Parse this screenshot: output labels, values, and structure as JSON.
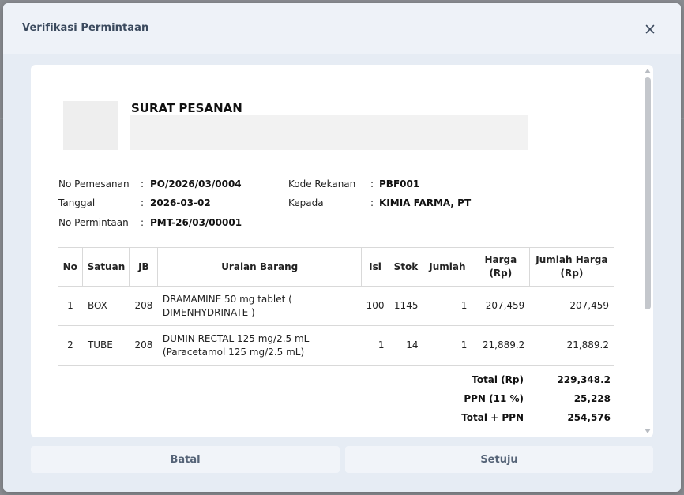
{
  "modal": {
    "title": "Verifikasi Permintaan"
  },
  "document": {
    "title": "SURAT PESANAN",
    "meta": {
      "no_pemesanan_label": "No Pemesanan",
      "no_pemesanan": "PO/2026/03/0004",
      "tanggal_label": "Tanggal",
      "tanggal": "2026-03-02",
      "no_permintaan_label": "No Permintaan",
      "no_permintaan": "PMT-26/03/00001",
      "kode_rekanan_label": "Kode Rekanan",
      "kode_rekanan": "PBF001",
      "kepada_label": "Kepada",
      "kepada": "KIMIA FARMA, PT",
      "colon": ":"
    },
    "table": {
      "headers": {
        "no": "No",
        "satuan": "Satuan",
        "jb": "JB",
        "uraian": "Uraian Barang",
        "isi": "Isi",
        "stok": "Stok",
        "jumlah": "Jumlah",
        "harga_1": "Harga",
        "harga_2": "(Rp)",
        "jumlah_harga_1": "Jumlah Harga",
        "jumlah_harga_2": "(Rp)"
      },
      "rows": [
        {
          "no": "1",
          "satuan": "BOX",
          "jb": "208",
          "uraian_1": "DRAMAMINE 50 mg tablet (",
          "uraian_2": "DIMENHYDRINATE )",
          "isi": "100",
          "stok": "1145",
          "jumlah": "1",
          "harga": "207,459",
          "jumlah_harga": "207,459"
        },
        {
          "no": "2",
          "satuan": "TUBE",
          "jb": "208",
          "uraian_1": "DUMIN RECTAL 125 mg/2.5 mL",
          "uraian_2": "(Paracetamol 125 mg/2.5 mL)",
          "isi": "1",
          "stok": "14",
          "jumlah": "1",
          "harga": "21,889.2",
          "jumlah_harga": "21,889.2"
        }
      ]
    },
    "totals": {
      "total_label": "Total (Rp)",
      "total": "229,348.2",
      "ppn_label": "PPN (11 %)",
      "ppn": "25,228",
      "grand_label": "Total + PPN",
      "grand": "254,576"
    }
  },
  "buttons": {
    "cancel": "Batal",
    "approve": "Setuju"
  },
  "icons": {
    "close": "close-icon",
    "scroll_up": "arrow-up-icon",
    "scroll_down": "arrow-down-icon"
  }
}
